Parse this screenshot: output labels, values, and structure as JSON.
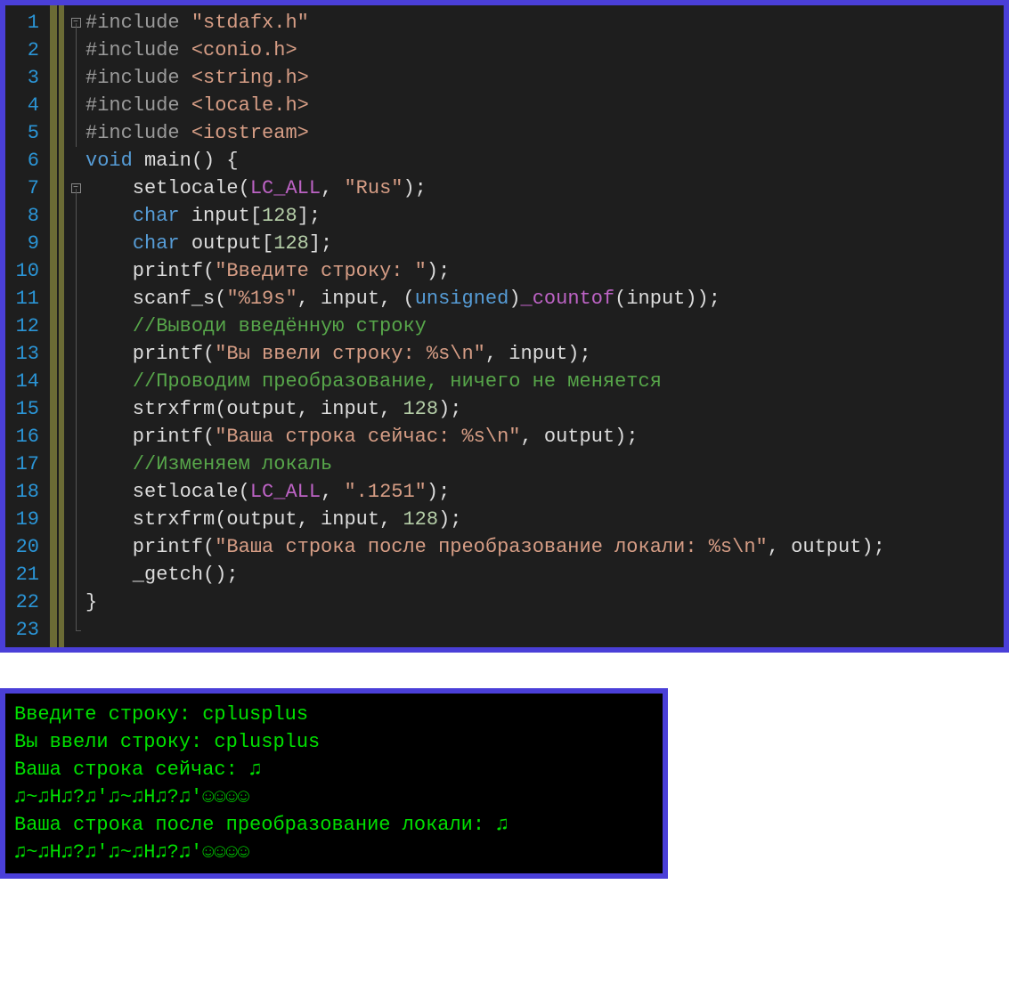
{
  "editor": {
    "line_numbers": [
      "1",
      "2",
      "3",
      "4",
      "5",
      "6",
      "7",
      "8",
      "9",
      "10",
      "11",
      "12",
      "13",
      "14",
      "15",
      "16",
      "17",
      "18",
      "19",
      "20",
      "21",
      "22",
      "23"
    ],
    "fold_markers": {
      "1": "-",
      "7": "-"
    },
    "lines": [
      {
        "tokens": [
          {
            "t": "#include ",
            "c": "prep"
          },
          {
            "t": "\"stdafx.h\"",
            "c": "str"
          }
        ]
      },
      {
        "tokens": [
          {
            "t": "#include ",
            "c": "prep"
          },
          {
            "t": "<conio.h>",
            "c": "str"
          }
        ]
      },
      {
        "tokens": [
          {
            "t": "#include ",
            "c": "prep"
          },
          {
            "t": "<string.h>",
            "c": "str"
          }
        ]
      },
      {
        "tokens": [
          {
            "t": "#include ",
            "c": "prep"
          },
          {
            "t": "<locale.h>",
            "c": "str"
          }
        ]
      },
      {
        "tokens": [
          {
            "t": "#include ",
            "c": "prep"
          },
          {
            "t": "<iostream>",
            "c": "str"
          }
        ]
      },
      {
        "tokens": [
          {
            "t": "",
            "c": "id"
          }
        ]
      },
      {
        "tokens": [
          {
            "t": "void",
            "c": "kw"
          },
          {
            "t": " main() {",
            "c": "id"
          }
        ]
      },
      {
        "tokens": [
          {
            "t": "    setlocale(",
            "c": "id"
          },
          {
            "t": "LC_ALL",
            "c": "macro"
          },
          {
            "t": ", ",
            "c": "id"
          },
          {
            "t": "\"Rus\"",
            "c": "str"
          },
          {
            "t": ");",
            "c": "id"
          }
        ]
      },
      {
        "tokens": [
          {
            "t": "    ",
            "c": "id"
          },
          {
            "t": "char",
            "c": "kw"
          },
          {
            "t": " input[",
            "c": "id"
          },
          {
            "t": "128",
            "c": "num"
          },
          {
            "t": "];",
            "c": "id"
          }
        ]
      },
      {
        "tokens": [
          {
            "t": "    ",
            "c": "id"
          },
          {
            "t": "char",
            "c": "kw"
          },
          {
            "t": " output[",
            "c": "id"
          },
          {
            "t": "128",
            "c": "num"
          },
          {
            "t": "];",
            "c": "id"
          }
        ]
      },
      {
        "tokens": [
          {
            "t": "    printf(",
            "c": "id"
          },
          {
            "t": "\"Введите строку: \"",
            "c": "str"
          },
          {
            "t": ");",
            "c": "id"
          }
        ]
      },
      {
        "tokens": [
          {
            "t": "    scanf_s(",
            "c": "id"
          },
          {
            "t": "\"%19s\"",
            "c": "str"
          },
          {
            "t": ", input, (",
            "c": "id"
          },
          {
            "t": "unsigned",
            "c": "kw"
          },
          {
            "t": ")",
            "c": "id"
          },
          {
            "t": "_countof",
            "c": "macro"
          },
          {
            "t": "(input));",
            "c": "id"
          }
        ]
      },
      {
        "tokens": [
          {
            "t": "    ",
            "c": "id"
          },
          {
            "t": "//Выводи введённую строку",
            "c": "cmt"
          }
        ]
      },
      {
        "tokens": [
          {
            "t": "    printf(",
            "c": "id"
          },
          {
            "t": "\"Вы ввели строку: %s\\n\"",
            "c": "str"
          },
          {
            "t": ", input);",
            "c": "id"
          }
        ]
      },
      {
        "tokens": [
          {
            "t": "    ",
            "c": "id"
          },
          {
            "t": "//Проводим преобразование, ничего не меняется",
            "c": "cmt"
          }
        ]
      },
      {
        "tokens": [
          {
            "t": "    strxfrm(output, input, ",
            "c": "id"
          },
          {
            "t": "128",
            "c": "num"
          },
          {
            "t": ");",
            "c": "id"
          }
        ]
      },
      {
        "tokens": [
          {
            "t": "    printf(",
            "c": "id"
          },
          {
            "t": "\"Ваша строка сейчас: %s\\n\"",
            "c": "str"
          },
          {
            "t": ", output);",
            "c": "id"
          }
        ]
      },
      {
        "tokens": [
          {
            "t": "    ",
            "c": "id"
          },
          {
            "t": "//Изменяем локаль",
            "c": "cmt"
          }
        ]
      },
      {
        "tokens": [
          {
            "t": "    setlocale(",
            "c": "id"
          },
          {
            "t": "LC_ALL",
            "c": "macro"
          },
          {
            "t": ", ",
            "c": "id"
          },
          {
            "t": "\".1251\"",
            "c": "str"
          },
          {
            "t": ");",
            "c": "id"
          }
        ]
      },
      {
        "tokens": [
          {
            "t": "    strxfrm(output, input, ",
            "c": "id"
          },
          {
            "t": "128",
            "c": "num"
          },
          {
            "t": ");",
            "c": "id"
          }
        ]
      },
      {
        "tokens": [
          {
            "t": "    printf(",
            "c": "id"
          },
          {
            "t": "\"Ваша строка после преобразование локали: %s\\n\"",
            "c": "str"
          },
          {
            "t": ", output);",
            "c": "id"
          }
        ]
      },
      {
        "tokens": [
          {
            "t": "    _getch();",
            "c": "id"
          }
        ]
      },
      {
        "tokens": [
          {
            "t": "}",
            "c": "id"
          }
        ]
      }
    ]
  },
  "console": {
    "lines": [
      "Введите строку: cplusplus",
      "Вы ввели строку: cplusplus",
      "Ваша строка сейчас: ♫",
      "♫~♫Н♫?♫'♫~♫Н♫?♫'☺☺☺☺",
      "Ваша строка после преобразование локали: ♫",
      "♫~♫Н♫?♫'♫~♫Н♫?♫'☺☺☺☺"
    ]
  }
}
